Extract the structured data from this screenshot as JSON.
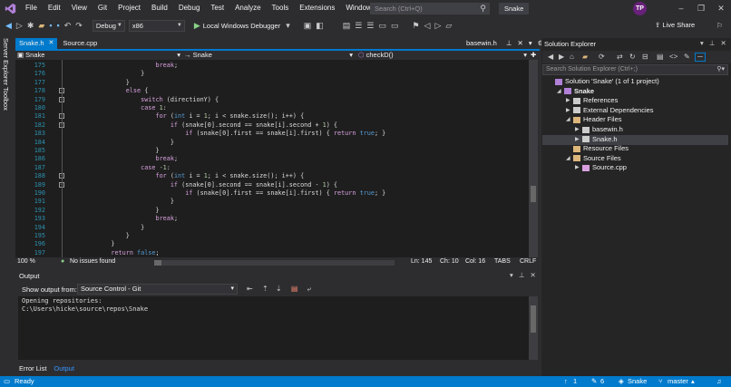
{
  "title_bar": {
    "menu": [
      "File",
      "Edit",
      "View",
      "Git",
      "Project",
      "Build",
      "Debug",
      "Test",
      "Analyze",
      "Tools",
      "Extensions",
      "Window",
      "Help"
    ],
    "search_placeholder": "Search (Ctrl+Q)",
    "app_name": "Snake",
    "avatar_initials": "TP"
  },
  "toolbar": {
    "config": "Debug",
    "platform": "x86",
    "run_label": "Local Windows Debugger",
    "live_share": "Live Share"
  },
  "side_tabs": [
    "Server Explorer",
    "Toolbox"
  ],
  "editor": {
    "tabs": [
      {
        "label": "Snake.h",
        "active": true
      },
      {
        "label": "Source.cpp",
        "active": false
      }
    ],
    "right_tab": "basewin.h",
    "nav_project": "Snake",
    "nav_scope": "Snake",
    "nav_member": "checkD()",
    "lines": [
      {
        "n": "175",
        "code": "                break;"
      },
      {
        "n": "176",
        "code": "            }"
      },
      {
        "n": "177",
        "code": "        }"
      },
      {
        "n": "178",
        "code": "        else {"
      },
      {
        "n": "179",
        "code": "            switch (directionY) {"
      },
      {
        "n": "180",
        "code": "            case 1:"
      },
      {
        "n": "181",
        "code": "                for (int i = 1; i < snake.size(); i++) {"
      },
      {
        "n": "182",
        "code": "                    if (snake[0].second == snake[i].second + 1) {"
      },
      {
        "n": "183",
        "code": "                        if (snake[0].first == snake[i].first) { return true; }"
      },
      {
        "n": "184",
        "code": "                    }"
      },
      {
        "n": "185",
        "code": "                }"
      },
      {
        "n": "186",
        "code": "                break;"
      },
      {
        "n": "187",
        "code": "            case -1:"
      },
      {
        "n": "188",
        "code": "                for (int i = 1; i < snake.size(); i++) {"
      },
      {
        "n": "189",
        "code": "                    if (snake[0].second == snake[i].second - 1) {"
      },
      {
        "n": "190",
        "code": "                        if (snake[0].first == snake[i].first) { return true; }"
      },
      {
        "n": "191",
        "code": "                    }"
      },
      {
        "n": "192",
        "code": "                }"
      },
      {
        "n": "193",
        "code": "                break;"
      },
      {
        "n": "194",
        "code": "            }"
      },
      {
        "n": "195",
        "code": "        }"
      },
      {
        "n": "196",
        "code": "    }"
      },
      {
        "n": "197",
        "code": "    return false;"
      }
    ],
    "zoom": "100 %",
    "issues": "No issues found",
    "ln": "Ln: 145",
    "ch": "Ch: 10",
    "col": "Col: 16",
    "tabs_mode": "TABS",
    "eol": "CRLF"
  },
  "output": {
    "title": "Output",
    "from_label": "Show output from:",
    "source": "Source Control - Git",
    "text": "Opening repositories:\nC:\\Users\\hicke\\source\\repos\\Snake",
    "bottom_tabs": [
      "Error List",
      "Output"
    ]
  },
  "solution_explorer": {
    "title": "Solution Explorer",
    "search_placeholder": "Search Solution Explorer (Ctrl+;)",
    "items": [
      {
        "label": "Solution 'Snake' (1 of 1 project)",
        "depth": 0,
        "tw": ""
      },
      {
        "label": "Snake",
        "depth": 1,
        "tw": "◢"
      },
      {
        "label": "References",
        "depth": 2,
        "tw": "▶"
      },
      {
        "label": "External Dependencies",
        "depth": 2,
        "tw": "▶"
      },
      {
        "label": "Header Files",
        "depth": 2,
        "tw": "◢"
      },
      {
        "label": "basewin.h",
        "depth": 3,
        "tw": "▶"
      },
      {
        "label": "Snake.h",
        "depth": 3,
        "tw": "▶"
      },
      {
        "label": "Resource Files",
        "depth": 2,
        "tw": ""
      },
      {
        "label": "Source Files",
        "depth": 2,
        "tw": "◢"
      },
      {
        "label": "Source.cpp",
        "depth": 3,
        "tw": "▶"
      }
    ]
  },
  "status_bar": {
    "state": "Ready",
    "up": "1",
    "edits": "6",
    "repo": "Snake",
    "branch": "master"
  }
}
